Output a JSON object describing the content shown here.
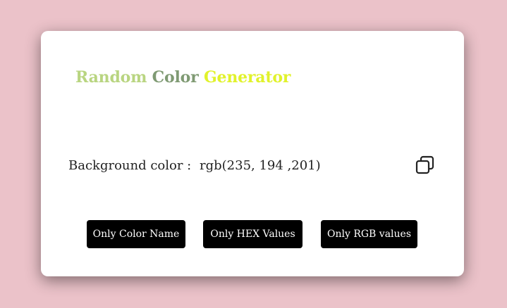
{
  "page": {
    "background_color": "#ebc2c9"
  },
  "title": {
    "words": [
      {
        "text": "Random",
        "color": "#b9d581"
      },
      {
        "text": "Color",
        "color": "#7f9a73"
      },
      {
        "text": "Generator",
        "color": "#e1f22b"
      }
    ]
  },
  "background": {
    "label": "Background color :",
    "value": "rgb(235, 194 ,201)"
  },
  "copy": {
    "icon": "copy-icon"
  },
  "buttons": {
    "color_name": "Only Color Name",
    "hex": "Only HEX Values",
    "rgb": "Only RGB values"
  }
}
